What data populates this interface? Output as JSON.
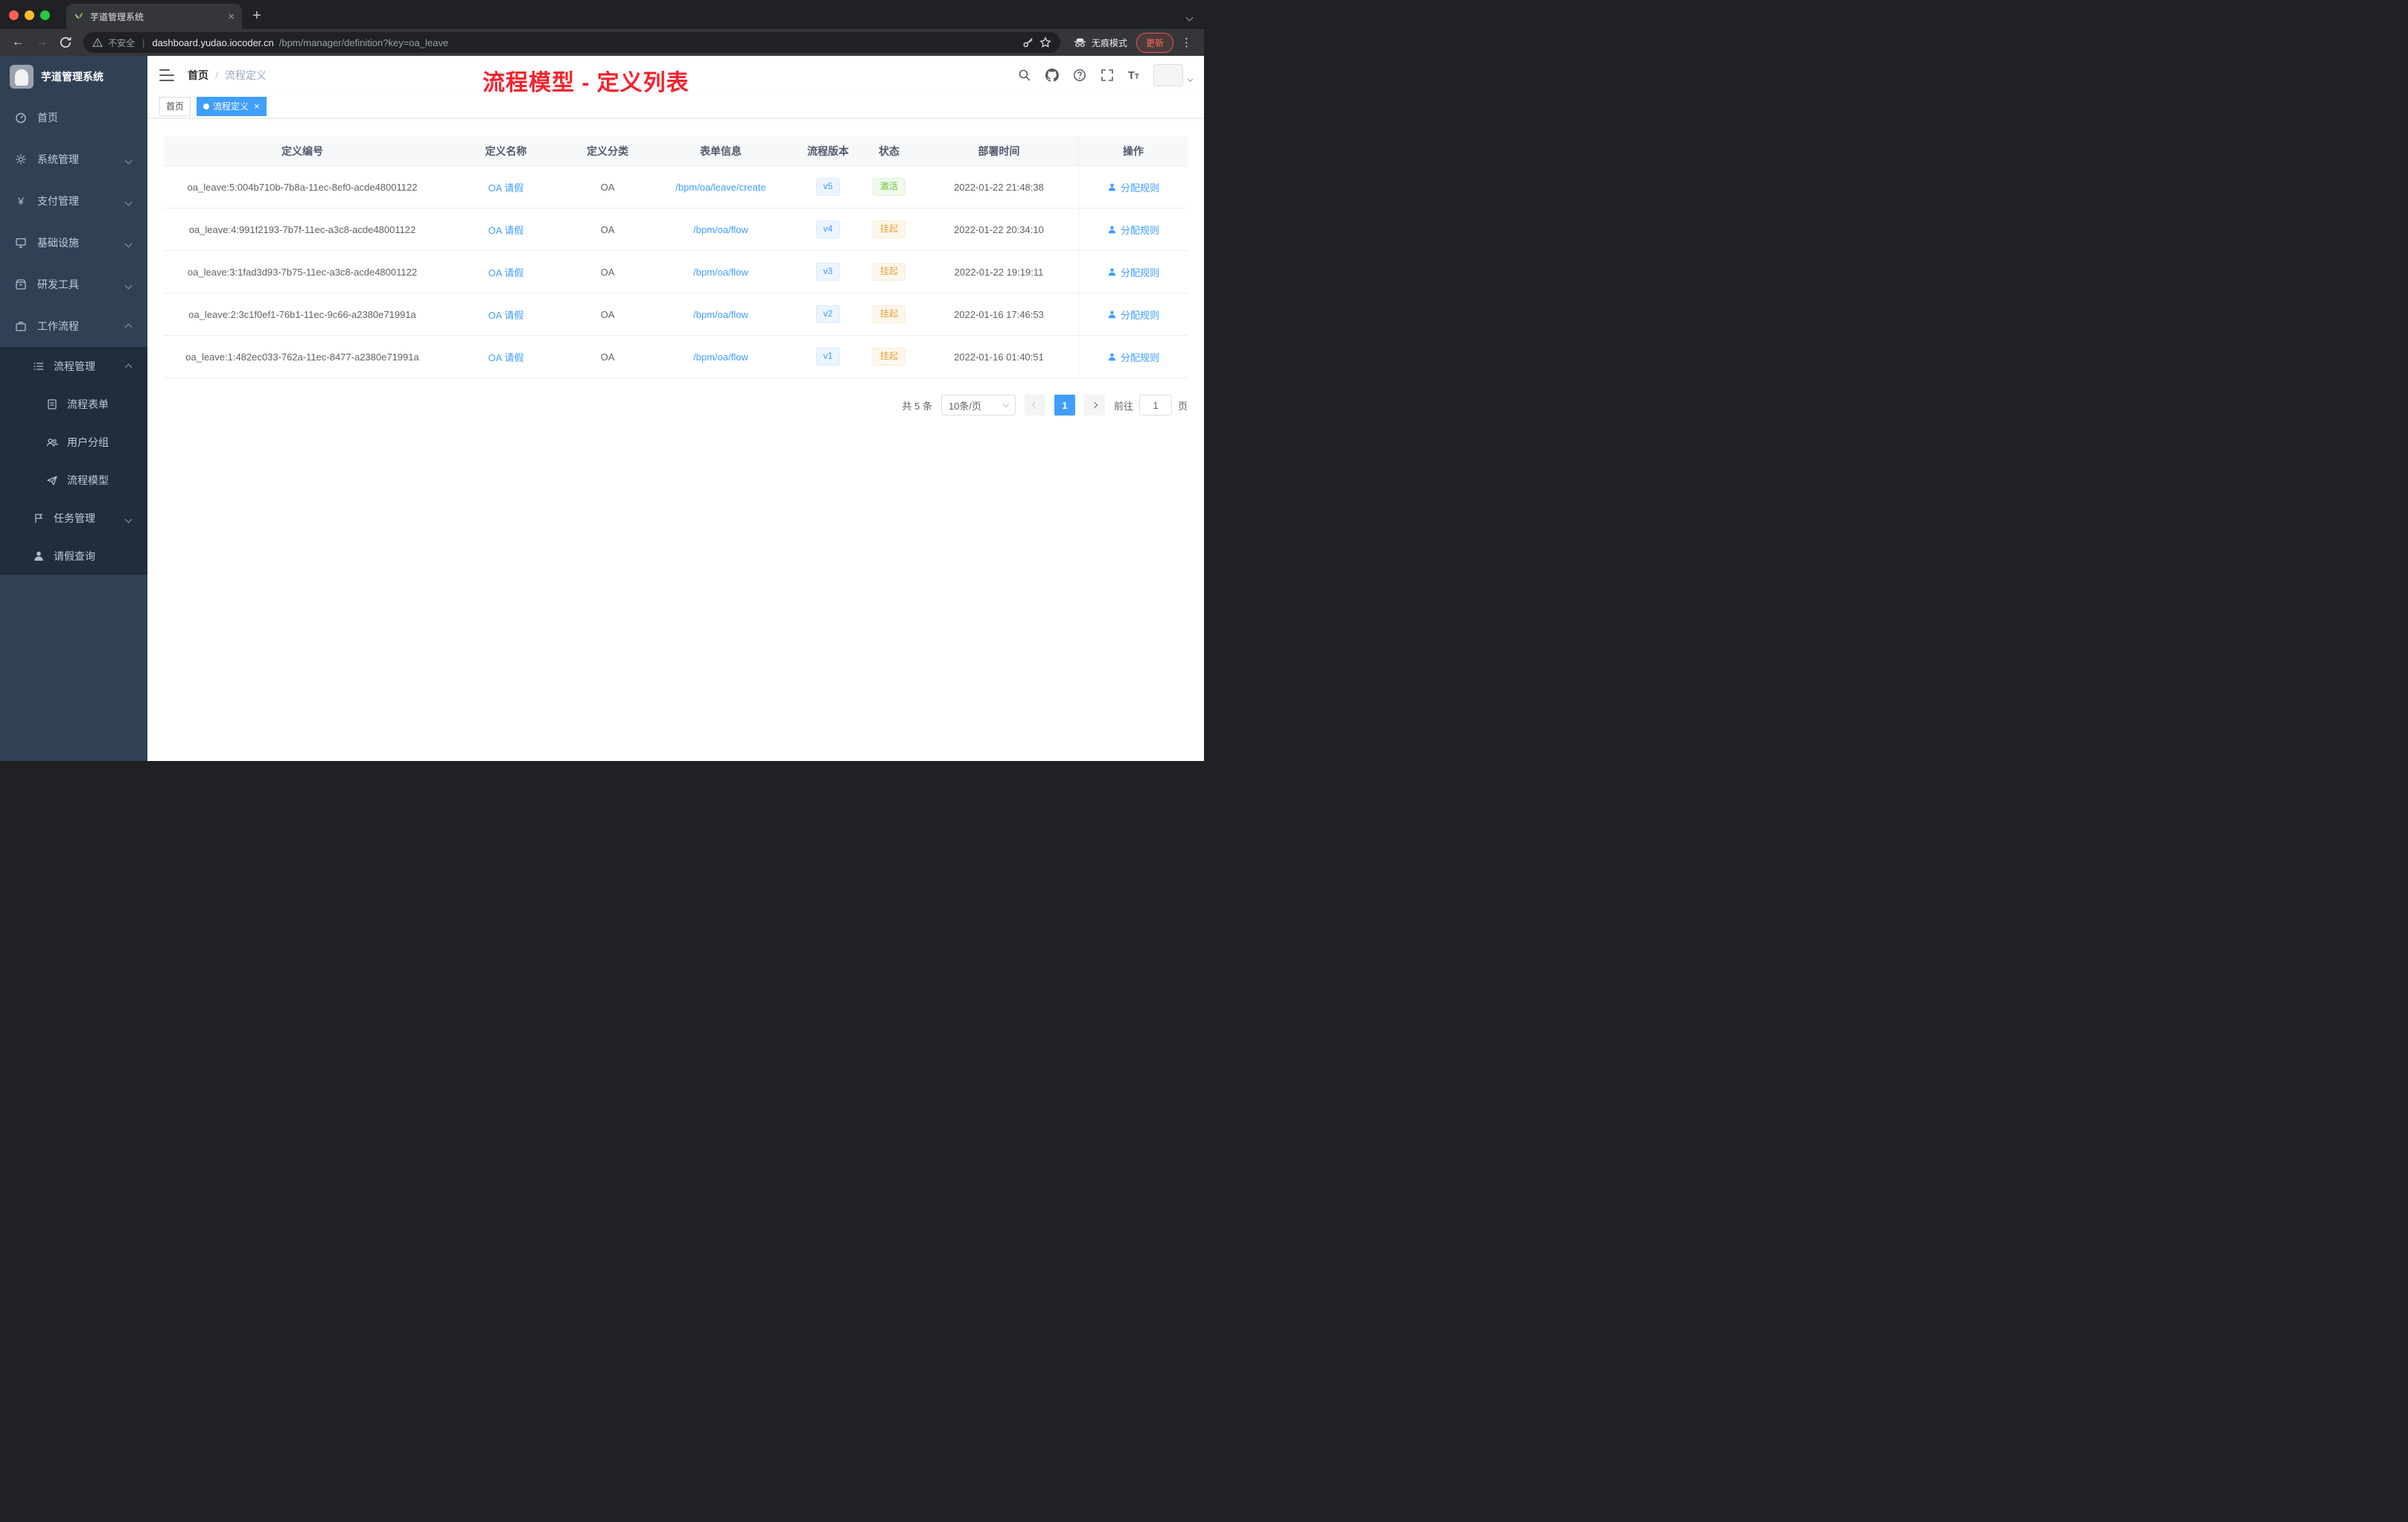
{
  "browser": {
    "tab_title": "芋道管理系统",
    "security_label": "不安全",
    "url_host": "dashboard.yudao.iocoder.cn",
    "url_path": "/bpm/manager/definition?key=oa_leave",
    "incognito_label": "无痕模式",
    "update_label": "更新"
  },
  "sidebar": {
    "logo_title": "芋道管理系统",
    "items": [
      {
        "label": "首页"
      },
      {
        "label": "系统管理"
      },
      {
        "label": "支付管理"
      },
      {
        "label": "基础设施"
      },
      {
        "label": "研发工具"
      },
      {
        "label": "工作流程"
      }
    ],
    "sub": {
      "manage": "流程管理",
      "form": "流程表单",
      "group": "用户分组",
      "model": "流程模型",
      "task": "任务管理",
      "leave": "请假查询"
    }
  },
  "header": {
    "breadcrumb_home": "首页",
    "breadcrumb_current": "流程定义",
    "annotation_title": "流程模型 - 定义列表"
  },
  "tags": {
    "home": "首页",
    "active": "流程定义"
  },
  "table": {
    "columns": [
      "定义编号",
      "定义名称",
      "定义分类",
      "表单信息",
      "流程版本",
      "状态",
      "部署时间",
      "操作"
    ],
    "rows": [
      {
        "id": "oa_leave:5:004b710b-7b8a-11ec-8ef0-acde48001122",
        "name": "OA 请假",
        "category": "OA",
        "form": "/bpm/oa/leave/create",
        "version": "v5",
        "status": "激活",
        "status_type": "success",
        "time": "2022-01-22 21:48:38",
        "action": "分配规则"
      },
      {
        "id": "oa_leave:4:991f2193-7b7f-11ec-a3c8-acde48001122",
        "name": "OA 请假",
        "category": "OA",
        "form": "/bpm/oa/flow",
        "version": "v4",
        "status": "挂起",
        "status_type": "warning",
        "time": "2022-01-22 20:34:10",
        "action": "分配规则"
      },
      {
        "id": "oa_leave:3:1fad3d93-7b75-11ec-a3c8-acde48001122",
        "name": "OA 请假",
        "category": "OA",
        "form": "/bpm/oa/flow",
        "version": "v3",
        "status": "挂起",
        "status_type": "warning",
        "time": "2022-01-22 19:19:11",
        "action": "分配规则"
      },
      {
        "id": "oa_leave:2:3c1f0ef1-76b1-11ec-9c66-a2380e71991a",
        "name": "OA 请假",
        "category": "OA",
        "form": "/bpm/oa/flow",
        "version": "v2",
        "status": "挂起",
        "status_type": "warning",
        "time": "2022-01-16 17:46:53",
        "action": "分配规则"
      },
      {
        "id": "oa_leave:1:482ec033-762a-11ec-8477-a2380e71991a",
        "name": "OA 请假",
        "category": "OA",
        "form": "/bpm/oa/flow",
        "version": "v1",
        "status": "挂起",
        "status_type": "warning",
        "time": "2022-01-16 01:40:51",
        "action": "分配规则"
      }
    ]
  },
  "pagination": {
    "total": "共 5 条",
    "page_size": "10条/页",
    "current_page": "1",
    "goto_label": "前往",
    "goto_value": "1",
    "goto_unit": "页"
  },
  "colors": {
    "accent": "#409eff",
    "success": "#67c23a",
    "warning": "#e6a23c",
    "annotation_red": "#f5222d",
    "sidebar_bg": "#304156",
    "submenu_bg": "#1f2d3d"
  },
  "icons": {
    "tab_favicon": "leaf-sprout",
    "security": "warning-triangle",
    "omnibox_right": [
      "key",
      "star"
    ],
    "navbar_right": [
      "search",
      "github",
      "question",
      "fullscreen",
      "font-size"
    ],
    "action": "user"
  }
}
